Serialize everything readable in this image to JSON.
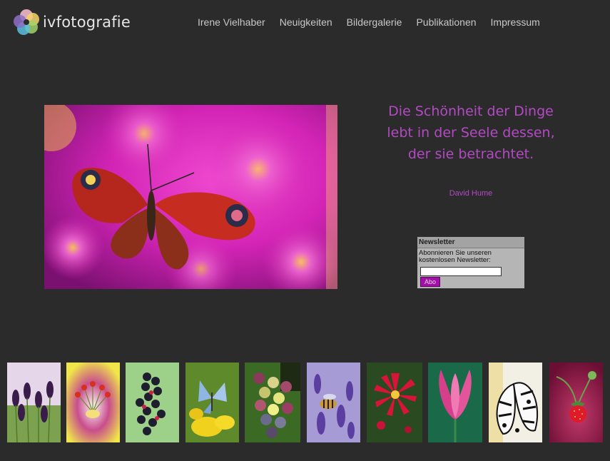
{
  "header": {
    "logo_text": "ivfotografie",
    "nav": [
      {
        "label": "Irene Vielhaber"
      },
      {
        "label": "Neuigkeiten"
      },
      {
        "label": "Bildergalerie"
      },
      {
        "label": "Publikationen"
      },
      {
        "label": "Impressum"
      }
    ]
  },
  "quote": {
    "lines": [
      "Die Schönheit der Dinge",
      "lebt in der Seele dessen,",
      "der sie betrachtet."
    ],
    "author": "David Hume"
  },
  "newsletter": {
    "title": "Newsletter",
    "text": "Abonnieren Sie unseren kostenlosen Newsletter:",
    "input_value": "",
    "button_label": "Abo"
  },
  "colors": {
    "background": "#2b2b2b",
    "accent": "#b34ac4",
    "button": "#a40fa8"
  },
  "hero": {
    "subject": "butterfly-on-pink-asters"
  },
  "thumbnails": [
    {
      "subject": "lavender-flowers"
    },
    {
      "subject": "flower-stamens"
    },
    {
      "subject": "dark-berries"
    },
    {
      "subject": "blue-butterfly-yellow-flowers"
    },
    {
      "subject": "grapes"
    },
    {
      "subject": "bee-on-lavender"
    },
    {
      "subject": "red-dahlia"
    },
    {
      "subject": "pink-tulip"
    },
    {
      "subject": "black-white-butterfly"
    },
    {
      "subject": "wild-strawberry"
    }
  ]
}
